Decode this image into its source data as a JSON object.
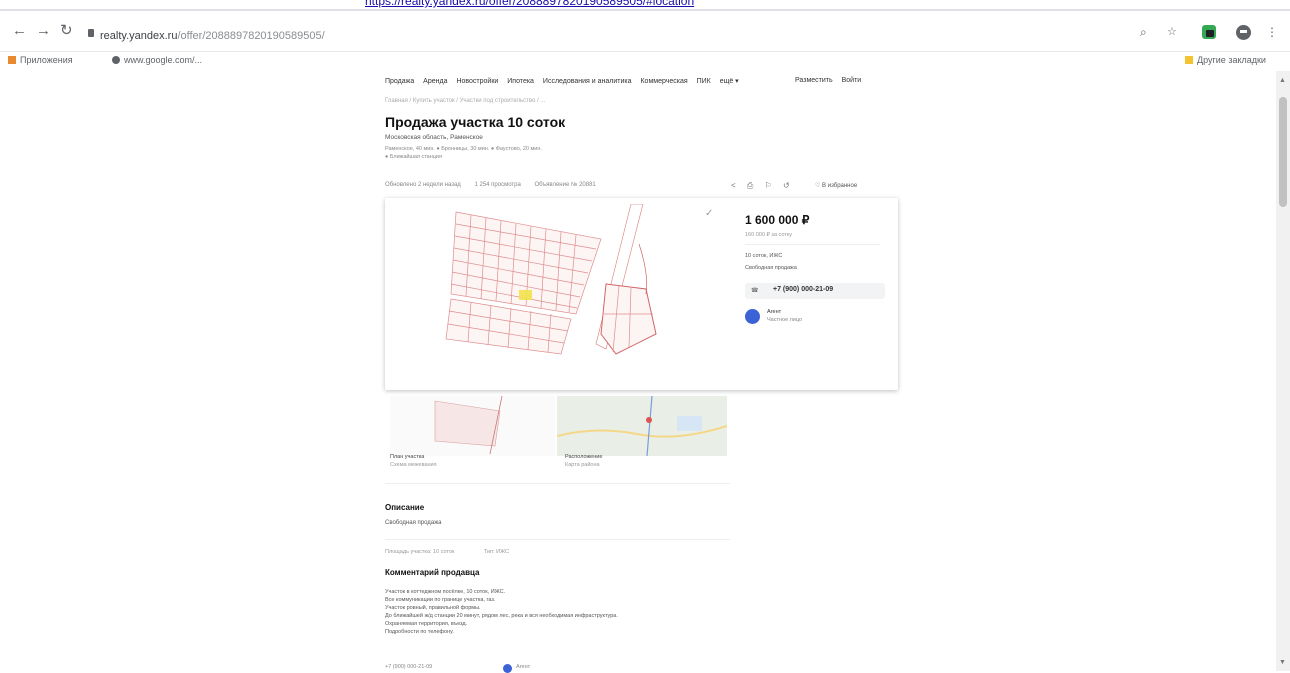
{
  "browser": {
    "link_above": "https://realty.yandex.ru/offer/2088897820190589505/#location",
    "url_host": "realty.yandex.ru",
    "url_path": "/offer/2088897820190589505/",
    "bookmarks": [
      "Приложения",
      "www.google.com/..."
    ],
    "other_bookmarks": "Другие закладки"
  },
  "site_nav": {
    "items": [
      "Продажа",
      "Аренда",
      "Новостройки",
      "Ипотека",
      "Исследования и аналитика",
      "Коммерческая",
      "ПИК",
      "ещё ▾"
    ],
    "right": [
      "Разместить",
      "Войти"
    ]
  },
  "listing": {
    "breadcrumbs": "Главная / Купить участок / Участки под строительство / ...",
    "title": "Продажа участка 10 соток",
    "address": "Московская область, Раменское",
    "metro_1": "Раменское, 40 мин. ● Бронницы, 30 мин. ● Фаустово, 20 мин.",
    "metro_2": "● Ближайшая станция",
    "meta": [
      "Обновлено 2 недели назад",
      "1 254 просмотра",
      "Объявление № 20881"
    ],
    "favorite": "В избранное",
    "action_icons": [
      "share-icon",
      "print-icon",
      "report-icon",
      "refresh-icon"
    ]
  },
  "price_card": {
    "price": "1 600 000 ₽",
    "price_sub": "160 000 ₽ за сотку",
    "info_1": "10 соток, ИЖС",
    "info_2": "Свободная продажа",
    "phone": "+7 (900) 000-21-09",
    "seller_name": "Агент",
    "seller_type": "Частное лицо"
  },
  "thumbnails": [
    {
      "label": "План участка",
      "sub": "Схема межевания"
    },
    {
      "label": "Расположение",
      "sub": "Карта района"
    }
  ],
  "description": {
    "heading": "Описание",
    "text": "Свободная продажа"
  },
  "props": [
    "Площадь участка: 10 соток",
    "Тип: ИЖС"
  ],
  "comment": {
    "heading": "Комментарий продавца",
    "lines": [
      "Участок в коттеджном посёлке, 10 соток, ИЖС.",
      "Все коммуникации по границе участка, газ.",
      "Участок ровный, правильной формы.",
      "До ближайшей ж/д станции 20 минут, рядом лес, река и вся необходимая инфраструктура.",
      "Охраняемая территория, въезд.",
      "Подробности по телефону."
    ]
  },
  "bottom": {
    "phone": "+7 (900) 000-21-09",
    "name": "Агент"
  }
}
